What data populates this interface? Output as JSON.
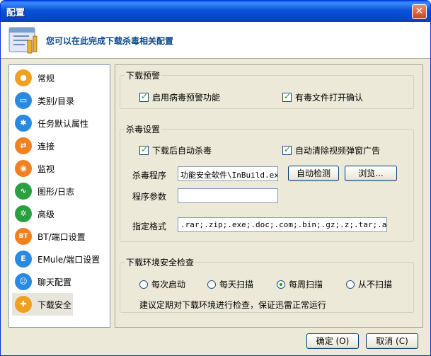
{
  "window": {
    "title": "配置"
  },
  "header": {
    "description": "您可以在此完成下载杀毒相关配置"
  },
  "sidebar": {
    "items": [
      {
        "label": "常规",
        "icon": "user-icon",
        "color": "#f0a020",
        "glyph": "●"
      },
      {
        "label": "类别/目录",
        "icon": "folder-icon",
        "color": "#2a8ae0",
        "glyph": "▭"
      },
      {
        "label": "任务默认属性",
        "icon": "gear-icon",
        "color": "#2a8ae0",
        "glyph": "✱"
      },
      {
        "label": "连接",
        "icon": "connect-icon",
        "color": "#f08020",
        "glyph": "⇄"
      },
      {
        "label": "监视",
        "icon": "monitor-icon",
        "color": "#f08020",
        "glyph": "◉"
      },
      {
        "label": "图形/日志",
        "icon": "graph-icon",
        "color": "#2aa040",
        "glyph": "∿"
      },
      {
        "label": "高级",
        "icon": "wheel-icon",
        "color": "#2aa040",
        "glyph": "✲"
      },
      {
        "label": "BT/端口设置",
        "icon": "bt-icon",
        "color": "#f08020",
        "glyph": "BT"
      },
      {
        "label": "EMule/端口设置",
        "icon": "emule-icon",
        "color": "#2a8ae0",
        "glyph": "E"
      },
      {
        "label": "聊天配置",
        "icon": "chat-icon",
        "color": "#2a8ae0",
        "glyph": "☺"
      },
      {
        "label": "下载安全",
        "icon": "shield-icon",
        "color": "#f0a020",
        "glyph": "✚",
        "active": true
      }
    ]
  },
  "download_alert": {
    "legend": "下载预警",
    "enable_alert": "启用病毒预警功能",
    "confirm_open": "有毒文件打开确认"
  },
  "antivirus": {
    "legend": "杀毒设置",
    "auto_scan": "下载后自动杀毒",
    "auto_clear_ads": "自动清除视频弹窗广告",
    "program_label": "杀毒程序",
    "program_value": "功能安全软件\\InBuild.exe",
    "auto_detect": "自动检测",
    "browse": "浏览...",
    "params_label": "程序参数",
    "params_value": "",
    "formats_label": "指定格式",
    "formats_value": ".rar;.zip;.exe;.doc;.com;.bin;.gz;.z;.tar;.arj;.l"
  },
  "env_check": {
    "legend": "下载环境安全检查",
    "options": [
      "每次启动",
      "每天扫描",
      "每周扫描",
      "从不扫描"
    ],
    "selected": "每周扫描",
    "note": "建议定期对下载环境进行检查，保证迅雷正常运行"
  },
  "footer": {
    "ok": "确定 (O)",
    "cancel": "取消 (C)"
  },
  "colors": {
    "title_bar": "#0a53d8",
    "header_text": "#0b4a8a",
    "check_mark": "#21a121"
  }
}
